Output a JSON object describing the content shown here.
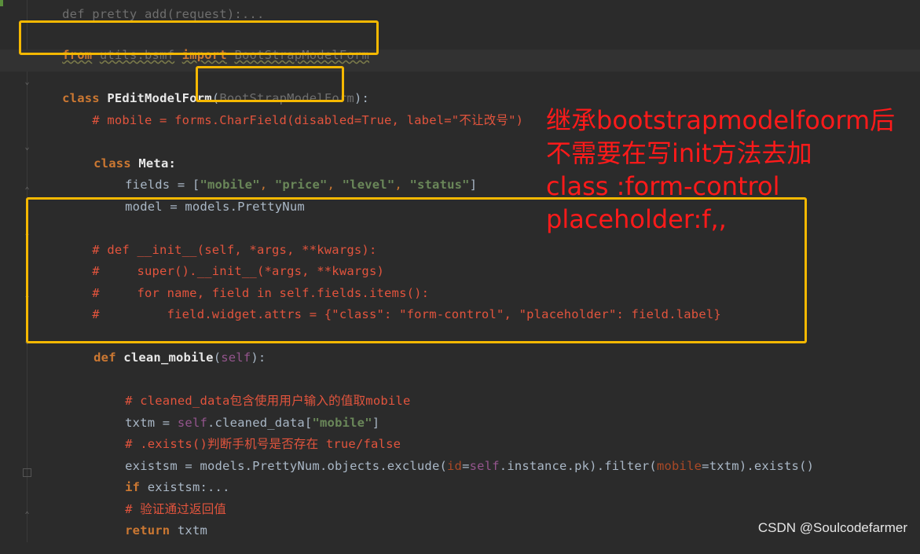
{
  "editor": {
    "lines": {
      "l0": "def pretty_add(request):...",
      "l1_from": "from",
      "l1_module": "utils.bsmf",
      "l1_import": "import",
      "l1_name": "BootStrapModelForm",
      "l3_class": "class",
      "l3_name": "PEditModelForm",
      "l3_base": "BootStrapModelForm",
      "l3_end": "):",
      "l4": "    # mobile = forms.CharField(disabled=True, label=\"不让改号\")",
      "l6_class": "class",
      "l6_name": "Meta:",
      "l7_a": "fields = [",
      "l7_s1": "\"mobile\"",
      "l7_s2": "\"price\"",
      "l7_s3": "\"level\"",
      "l7_s4": "\"status\"",
      "l7_b": "]",
      "l8": "model = models.PrettyNum",
      "l10": "    # def __init__(self, *args, **kwargs):",
      "l11": "    #     super().__init__(*args, **kwargs)",
      "l12": "    #     for name, field in self.fields.items():",
      "l13": "    #         field.widget.attrs = {\"class\": \"form-control\", \"placeholder\": field.label}",
      "l15_def": "def",
      "l15_name": "clean_mobile",
      "l15_self": "self",
      "l15_end": "):",
      "l17": "# cleaned_data包含使用用户输入的值取mobile",
      "l18_a": "txtm = ",
      "l18_self": "self",
      "l18_b": ".cleaned_data[",
      "l18_s": "\"mobile\"",
      "l18_c": "]",
      "l19": "# .exists()判断手机号是否存在 true/false",
      "l20_a": "existsm = models.PrettyNum.objects.exclude(",
      "l20_k1": "id",
      "l20_eq1": "=",
      "l20_self": "self",
      "l20_b": ".instance.pk).filter(",
      "l20_k2": "mobile",
      "l20_c": "=txtm).exists()",
      "l21_if": "if",
      "l21_rest": " existsm:",
      "l21_dots": "...",
      "l22": "# 验证通过返回值",
      "l23_ret": "return",
      "l23_rest": " txtm"
    }
  },
  "annotation": {
    "line1": "继承bootstrapmodelfoorm后",
    "line2": "不需要在写init方法去加",
    "line3": "class :form-control",
    "line4": "placeholder:f,,"
  },
  "watermark": "CSDN @Soulcodefarmer",
  "colors": {
    "highlight_box": "#f5b800",
    "annotation_text": "#ff1a1a",
    "background": "#2b2b2b"
  }
}
